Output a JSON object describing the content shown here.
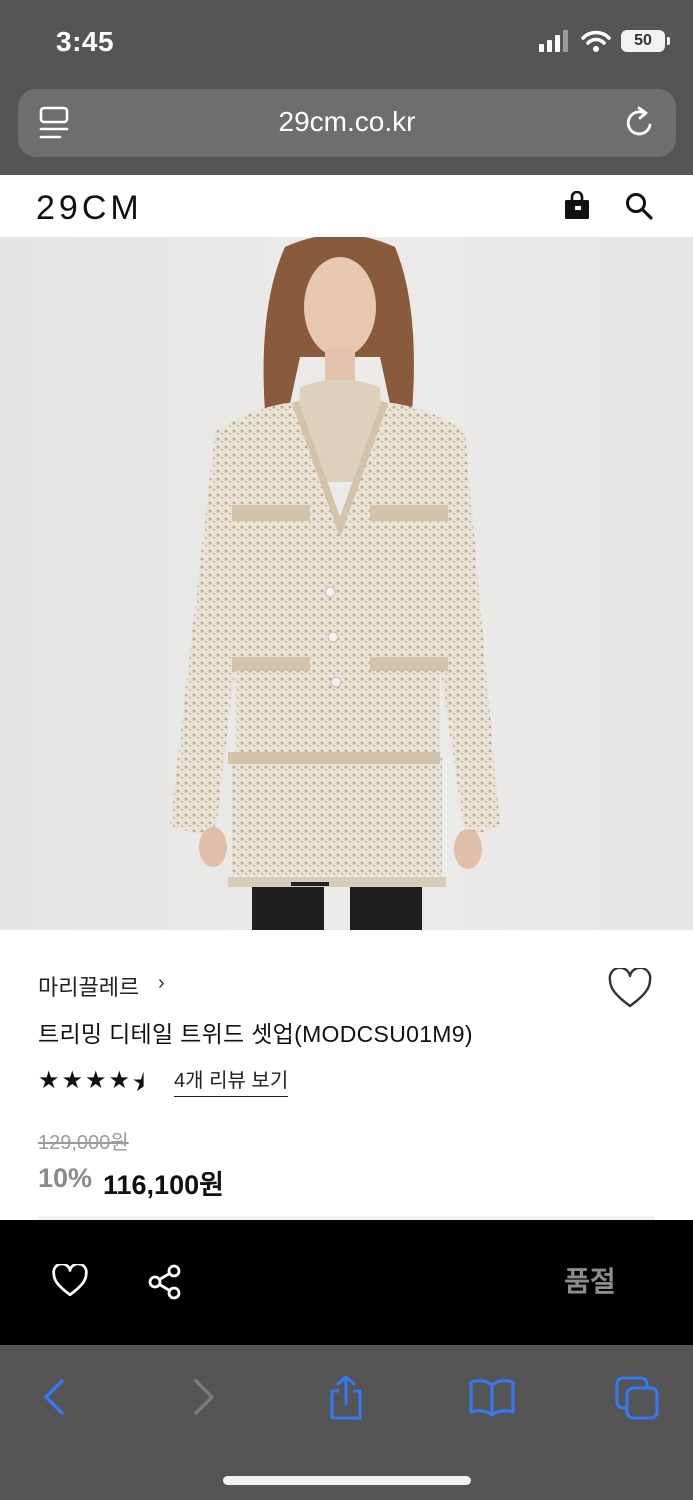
{
  "status_bar": {
    "time": "3:45",
    "battery": "50"
  },
  "browser": {
    "url": "29cm.co.kr"
  },
  "site": {
    "logo": "29CM"
  },
  "product": {
    "brand": "마리끌레르",
    "brand_chevron": "›",
    "name": "트리밍 디테일 트위드 셋업(MODCSU01M9)",
    "rating": 4.5,
    "stars": [
      "★",
      "★",
      "★",
      "★",
      "⯨"
    ],
    "review_link": "4개 리뷰 보기",
    "original_price": "129,000원",
    "discount_rate": "10%",
    "sale_price": "116,100원"
  },
  "bottom_bar": {
    "soldout_label": "품절"
  },
  "colors": {
    "accent": "#3478f6",
    "black": "#000000",
    "browser_chrome": "#555555"
  },
  "icons": [
    "tabs-overview-icon",
    "reload-icon",
    "shopping-bag-icon",
    "search-icon",
    "heart-icon",
    "share-icon",
    "back-icon",
    "forward-icon",
    "share-sheet-icon",
    "bookmarks-icon",
    "tabs-icon"
  ]
}
